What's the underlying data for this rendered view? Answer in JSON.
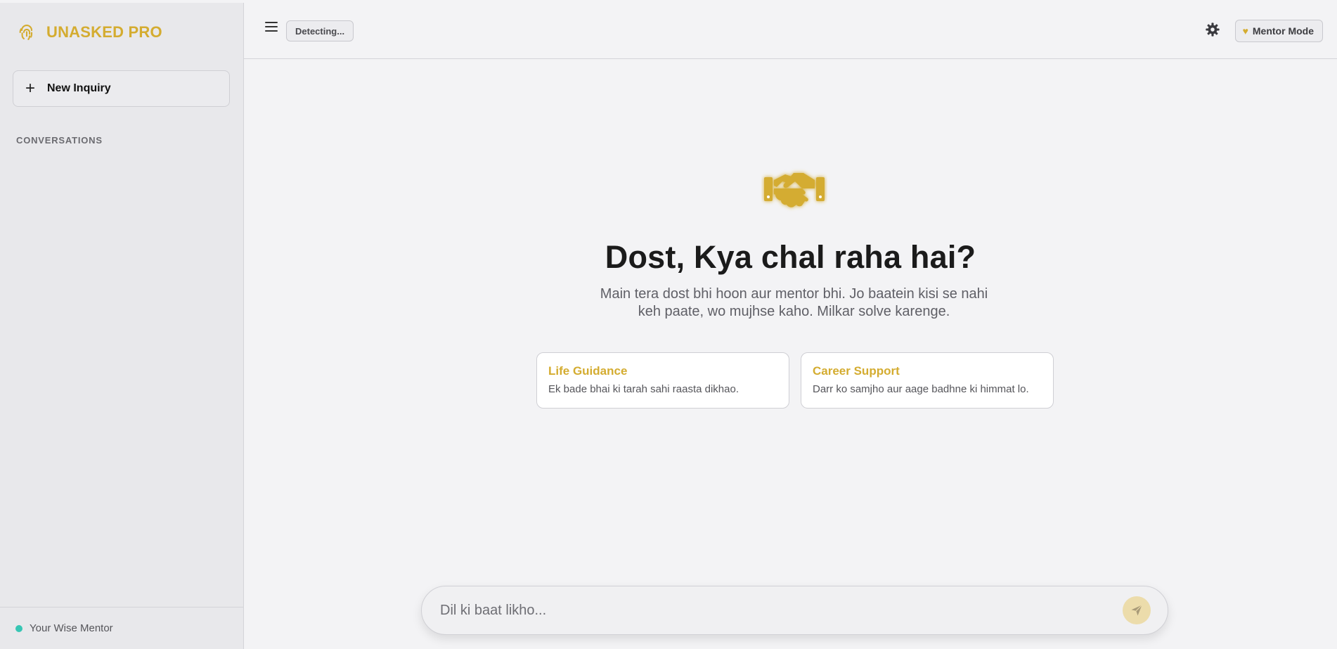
{
  "brand": {
    "title": "UNASKED PRO",
    "icon": "fingerprint-icon",
    "accent": "#d4ac30"
  },
  "sidebar": {
    "new_inquiry_label": "New Inquiry",
    "conversations_heading": "CONVERSATIONS",
    "conversations": [],
    "footer": {
      "label": "Your Wise Mentor",
      "status_color": "#37c6b4"
    }
  },
  "topbar": {
    "detect_label": "Detecting...",
    "mode_label": "Mentor Mode",
    "mode_icon": "heart-icon",
    "settings_icon": "gear-icon"
  },
  "hero": {
    "icon": "handshake-icon",
    "title": "Dost, Kya chal raha hai?",
    "subtitle": "Main tera dost bhi hoon aur mentor bhi. Jo baatein kisi se nahi keh paate, wo mujhse kaho. Milkar solve karenge."
  },
  "cards": [
    {
      "title": "Life Guidance",
      "desc": "Ek bade bhai ki tarah sahi raasta dikhao."
    },
    {
      "title": "Career Support",
      "desc": "Darr ko samjho aur aage badhne ki himmat lo."
    }
  ],
  "composer": {
    "placeholder": "Dil ki baat likho...",
    "send_icon": "send-icon"
  }
}
